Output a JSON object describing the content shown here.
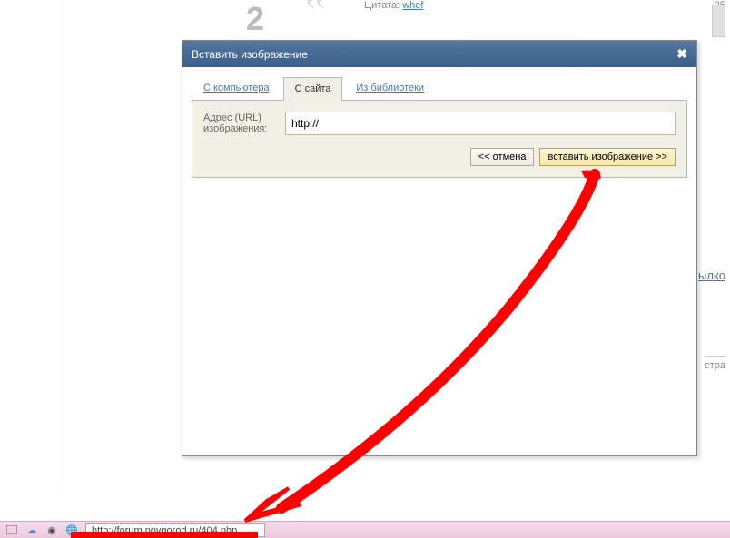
{
  "background": {
    "vote_number": "2",
    "quote_prefix": "Цитата:",
    "quote_author": "whef",
    "thumb_time": "25",
    "link_text": "ылко",
    "page_label": "стра"
  },
  "modal": {
    "title": "Вставить изображение",
    "tabs": {
      "computer": "С компьютера",
      "site": "С сайта",
      "library": "Из библиотеки"
    },
    "url_label": "Адрес (URL) изображения:",
    "url_value": "http://",
    "cancel_btn": "<< отмена",
    "insert_btn": "вставить изображение >>"
  },
  "taskbar": {
    "url": "http://forum.novgorod.ru/404.php"
  }
}
